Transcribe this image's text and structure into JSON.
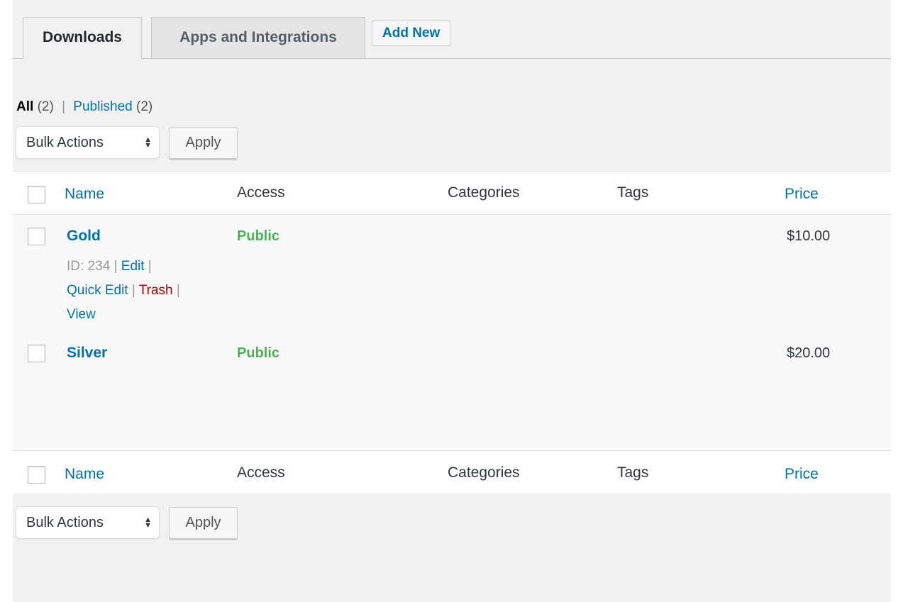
{
  "tabs": {
    "downloads": "Downloads",
    "apps": "Apps and Integrations",
    "add_new": "Add New"
  },
  "filters": {
    "all_label": "All",
    "all_count": "(2)",
    "separator": "|",
    "published_label": "Published",
    "published_count": "(2)"
  },
  "bulk": {
    "select_label": "Bulk Actions",
    "arrows": "⬍",
    "apply_label": "Apply"
  },
  "table": {
    "columns": {
      "name": "Name",
      "access": "Access",
      "categories": "Categories",
      "tags": "Tags",
      "price": "Price"
    },
    "rows": [
      {
        "name": "Gold",
        "access": "Public",
        "price": "$10.00",
        "id_text": "ID: 234",
        "actions": {
          "edit": "Edit",
          "quick_edit": "Quick Edit",
          "trash": "Trash",
          "view": "View",
          "pipe": "|"
        }
      },
      {
        "name": "Silver",
        "access": "Public",
        "price": "$20.00"
      }
    ]
  },
  "colors": {
    "link": "#0073aa",
    "public": "#46b450",
    "trash": "#aa0000",
    "background": "#f1f1f1"
  }
}
